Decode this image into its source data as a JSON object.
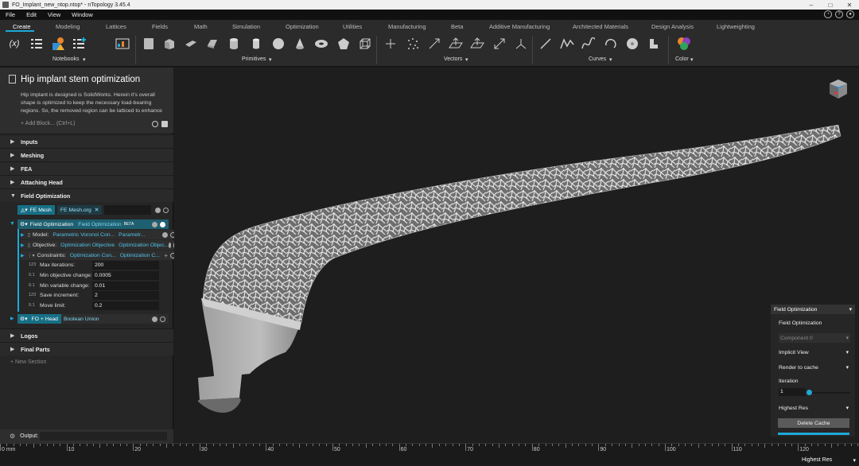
{
  "window": {
    "title": "FO_Implant_new_ntop.ntop* - nTopology 3.45.4"
  },
  "menu": [
    "File",
    "Edit",
    "View",
    "Window"
  ],
  "ribbon": {
    "tabs": [
      "Create",
      "Modeling",
      "Lattices",
      "Fields",
      "Math",
      "Simulation",
      "Optimization",
      "Utilities",
      "Manufacturing",
      "Beta",
      "Additive Manufacturing",
      "Architected Materials",
      "Design Analysis",
      "Lightweighting"
    ],
    "active_tab": "Create",
    "groups": [
      {
        "label": "Notebooks",
        "icons": [
          "variable-icon",
          "list-icon",
          "shapes-icon",
          "list-add-icon",
          "chart-icon"
        ]
      },
      {
        "label": "Primitives",
        "icons": [
          "cube-icon",
          "box-icon",
          "plane-icon",
          "prism-icon",
          "cylinder-icon",
          "sphere-icon",
          "cone-icon",
          "torus-icon",
          "pentagon-icon",
          "wire-cube-icon"
        ]
      },
      {
        "label": "Vectors",
        "icons": [
          "point-icon",
          "point-cloud-icon",
          "vector-icon",
          "plane-vector-icon",
          "vector-arrows-icon",
          "coordinate-system-icon"
        ]
      },
      {
        "label": "Curves",
        "icons": [
          "line-icon",
          "polyline-icon",
          "spline-icon",
          "arc-icon",
          "circle-icon",
          "extrude-icon"
        ]
      },
      {
        "label": "Color",
        "icons": [
          "color-icon"
        ]
      }
    ]
  },
  "notebook": {
    "title": "Hip implant stem optimization",
    "description": "Hip implant is designed is SolidWorks. Herein it's overall shape is optimized to keep the necessary load-bearing regions. So, the removed region can be latticed to enhance",
    "add_block": "Add Block... (Ctrl+L)",
    "sections_top": [
      "Inputs",
      "Meshing",
      "FEA",
      "Attaching Head",
      "Field Optimization"
    ],
    "fe_mesh_chip": "FE Mesh",
    "fe_mesh_value": "FE Mesh.org",
    "fo_block": {
      "title": "Field Optimization",
      "subtitle": "Field Optimization",
      "beta": "BETA"
    },
    "inputs": [
      {
        "label": "Model:",
        "value": "Parametric Voronoi Con...",
        "extra": "Parametr..."
      },
      {
        "label": "Objective:",
        "value": "Optimization Objective",
        "extra": "Optimization Objec..."
      },
      {
        "label": "Constraints:",
        "value": "Optimization Con...",
        "extra": "Optimization C..."
      }
    ],
    "params": [
      {
        "label": "Max iterations:",
        "value": "200"
      },
      {
        "label": "Min objective change:",
        "value": "0.0005"
      },
      {
        "label": "Min variable change:",
        "value": "0.01"
      },
      {
        "label": "Save increment:",
        "value": "2"
      },
      {
        "label": "Move limit:",
        "value": "0.2"
      }
    ],
    "fo_head": {
      "title": "FO + Head",
      "subtitle": "Boolean Union"
    },
    "sections_bottom": [
      "Logos",
      "Final Parts"
    ],
    "new_section": "New Section",
    "output": "Output:"
  },
  "overlay": {
    "header": "Field Optimization",
    "label": "Field Optimization",
    "component": "Component 0",
    "view": "Implicit View",
    "cache": "Render to cache",
    "iteration_label": "Iteration",
    "iteration_value": "1",
    "iteration_fraction": 0.0,
    "resolution": "Highest Res",
    "delete_button": "Delete Cache"
  },
  "ruler": {
    "start_label": "0 mm",
    "labels": [
      "10",
      "20",
      "30",
      "40",
      "50",
      "60",
      "70",
      "80",
      "90",
      "100",
      "110",
      "120"
    ]
  },
  "status": {
    "resolution": "Highest Res"
  },
  "colors": {
    "accent": "#1ea9d8",
    "block_teal": "#176f86",
    "link_blue": "#4fc3ea"
  }
}
